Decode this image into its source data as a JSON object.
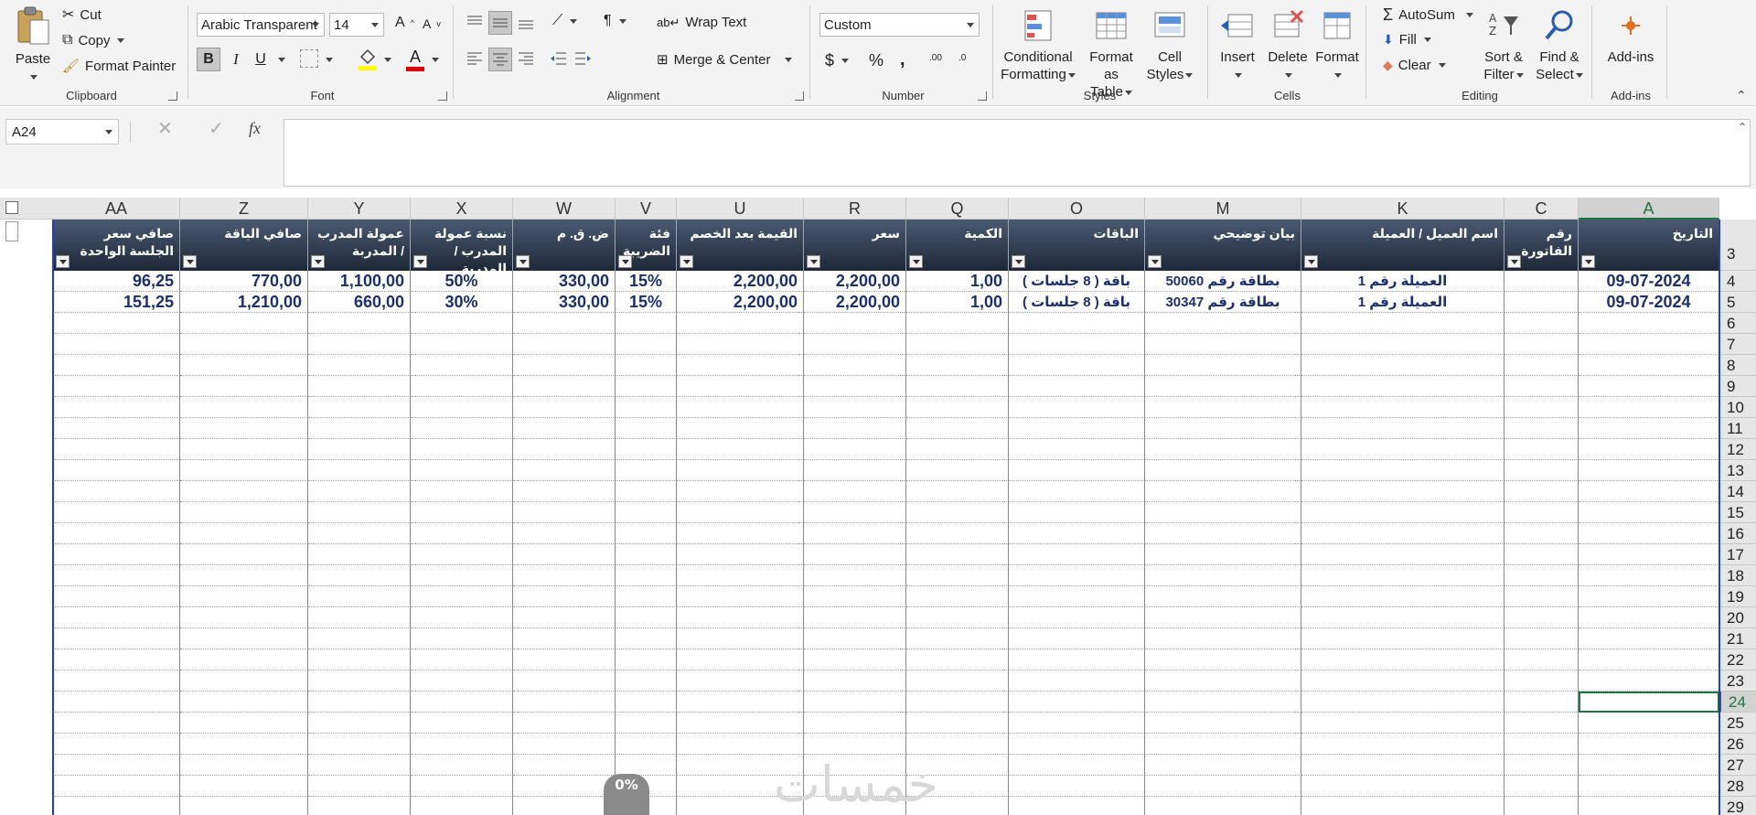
{
  "ribbon": {
    "clipboard": {
      "paste": "Paste",
      "cut": "Cut",
      "copy": "Copy",
      "format_painter": "Format Painter",
      "label": "Clipboard"
    },
    "font": {
      "name": "Arabic Transparent",
      "size": "14",
      "label": "Font",
      "bold": "B",
      "italic": "I",
      "underline": "U",
      "grow": "A",
      "shrink": "A",
      "font_color_glyph": "A"
    },
    "alignment": {
      "wrap_text": "Wrap Text",
      "merge_center": "Merge & Center",
      "label": "Alignment"
    },
    "number": {
      "format": "Custom",
      "currency": "$",
      "percent": "%",
      "comma": ",",
      "inc_decimal": ".00",
      "dec_decimal": ".0",
      "label": "Number"
    },
    "styles": {
      "conditional_1": "Conditional",
      "conditional_2": "Formatting",
      "format_table_1": "Format as",
      "format_table_2": "Table",
      "cell_styles_1": "Cell",
      "cell_styles_2": "Styles",
      "label": "Styles"
    },
    "cells": {
      "insert": "Insert",
      "delete": "Delete",
      "format": "Format",
      "label": "Cells"
    },
    "editing": {
      "autosum": "AutoSum",
      "fill": "Fill",
      "clear": "Clear",
      "sort_1": "Sort &",
      "sort_2": "Filter",
      "find_1": "Find &",
      "find_2": "Select",
      "label": "Editing"
    },
    "addins": {
      "addins": "Add-ins",
      "label": "Add-ins"
    }
  },
  "formula_bar": {
    "name_box": "A24",
    "cancel": "✕",
    "enter": "✓",
    "fx": "fx",
    "value": ""
  },
  "columns": [
    {
      "letter": "AA",
      "header": "صافي سعر الجلسة الواحدة"
    },
    {
      "letter": "Z",
      "header": "صافي الباقة"
    },
    {
      "letter": "Y",
      "header": "عمولة المدرب / المدربة"
    },
    {
      "letter": "X",
      "header": "نسبة عمولة المدرب / المدربة"
    },
    {
      "letter": "W",
      "header": "ض. ق. م"
    },
    {
      "letter": "V",
      "header": "فئة الضريبة"
    },
    {
      "letter": "U",
      "header": "القيمة بعد الخصم"
    },
    {
      "letter": "R",
      "header": "سعر"
    },
    {
      "letter": "Q",
      "header": "الكمية"
    },
    {
      "letter": "O",
      "header": "الباقات"
    },
    {
      "letter": "M",
      "header": "بيان توضيحي"
    },
    {
      "letter": "K",
      "header": "اسم العميل / العميلة"
    },
    {
      "letter": "C",
      "header": "رقم الفاتورة"
    },
    {
      "letter": "A",
      "header": "التاريخ"
    }
  ],
  "header_row_number": "3",
  "rows": [
    {
      "num": "4",
      "cells": [
        "96,25",
        "770,00",
        "1,100,00",
        "50%",
        "330,00",
        "15%",
        "2,200,00",
        "2,200,00",
        "1,00",
        "باقة ( 8 جلسات )",
        "بطاقة رقم 50060",
        "العميلة رقم 1",
        "",
        "09-07-2024"
      ]
    },
    {
      "num": "5",
      "cells": [
        "151,25",
        "1,210,00",
        "660,00",
        "30%",
        "330,00",
        "15%",
        "2,200,00",
        "2,200,00",
        "1,00",
        "باقة ( 8 جلسات )",
        "بطاقة رقم 30347",
        "العميلة رقم 1",
        "",
        "09-07-2024"
      ]
    }
  ],
  "empty_rows": [
    "6",
    "7",
    "8",
    "9",
    "10",
    "11",
    "12",
    "13",
    "14",
    "15",
    "16",
    "17",
    "18",
    "19",
    "20",
    "21",
    "22",
    "23",
    "24",
    "25",
    "26",
    "27",
    "28",
    "29"
  ],
  "selected_row": "24",
  "selected_col": "A",
  "watermark": {
    "text": "خمسات",
    "badge": "0%"
  },
  "colors": {
    "header_dark": "#1e2838",
    "data_text": "#1f2f6b",
    "accent": "#217346"
  }
}
